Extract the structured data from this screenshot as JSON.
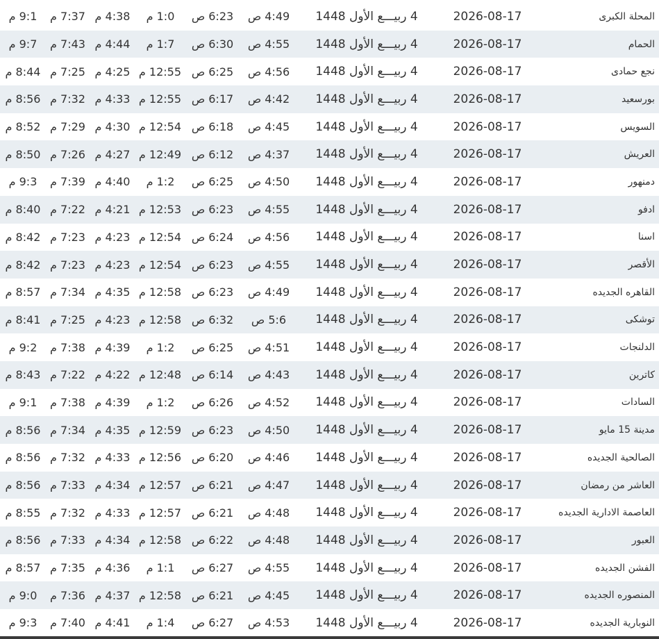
{
  "rows": [
    {
      "city": "المحلة الكبرى",
      "greg": "2026-08-17",
      "hijri": "4 ربيـــع الأول 1448",
      "fajr": "4:49 ص",
      "shuruq": "6:23 ص",
      "dhuhr": "1:0 م",
      "asr": "4:38 م",
      "maghrib": "7:37 م",
      "isha": "9:1 م"
    },
    {
      "city": "الحمام",
      "greg": "2026-08-17",
      "hijri": "4 ربيـــع الأول 1448",
      "fajr": "4:55 ص",
      "shuruq": "6:30 ص",
      "dhuhr": "1:7 م",
      "asr": "4:44 م",
      "maghrib": "7:43 م",
      "isha": "9:7 م"
    },
    {
      "city": "نجع حمادى",
      "greg": "2026-08-17",
      "hijri": "4 ربيـــع الأول 1448",
      "fajr": "4:56 ص",
      "shuruq": "6:25 ص",
      "dhuhr": "12:55 م",
      "asr": "4:25 م",
      "maghrib": "7:25 م",
      "isha": "8:44 م"
    },
    {
      "city": "بورسعيد",
      "greg": "2026-08-17",
      "hijri": "4 ربيـــع الأول 1448",
      "fajr": "4:42 ص",
      "shuruq": "6:17 ص",
      "dhuhr": "12:55 م",
      "asr": "4:33 م",
      "maghrib": "7:32 م",
      "isha": "8:56 م"
    },
    {
      "city": "السويس",
      "greg": "2026-08-17",
      "hijri": "4 ربيـــع الأول 1448",
      "fajr": "4:45 ص",
      "shuruq": "6:18 ص",
      "dhuhr": "12:54 م",
      "asr": "4:30 م",
      "maghrib": "7:29 م",
      "isha": "8:52 م"
    },
    {
      "city": "العريش",
      "greg": "2026-08-17",
      "hijri": "4 ربيـــع الأول 1448",
      "fajr": "4:37 ص",
      "shuruq": "6:12 ص",
      "dhuhr": "12:49 م",
      "asr": "4:27 م",
      "maghrib": "7:26 م",
      "isha": "8:50 م"
    },
    {
      "city": "دمنهور",
      "greg": "2026-08-17",
      "hijri": "4 ربيـــع الأول 1448",
      "fajr": "4:50 ص",
      "shuruq": "6:25 ص",
      "dhuhr": "1:2 م",
      "asr": "4:40 م",
      "maghrib": "7:39 م",
      "isha": "9:3 م"
    },
    {
      "city": "ادفو",
      "greg": "2026-08-17",
      "hijri": "4 ربيـــع الأول 1448",
      "fajr": "4:55 ص",
      "shuruq": "6:23 ص",
      "dhuhr": "12:53 م",
      "asr": "4:21 م",
      "maghrib": "7:22 م",
      "isha": "8:40 م"
    },
    {
      "city": "اسنا",
      "greg": "2026-08-17",
      "hijri": "4 ربيـــع الأول 1448",
      "fajr": "4:56 ص",
      "shuruq": "6:24 ص",
      "dhuhr": "12:54 م",
      "asr": "4:23 م",
      "maghrib": "7:23 م",
      "isha": "8:42 م"
    },
    {
      "city": "الأقصر",
      "greg": "2026-08-17",
      "hijri": "4 ربيـــع الأول 1448",
      "fajr": "4:55 ص",
      "shuruq": "6:23 ص",
      "dhuhr": "12:54 م",
      "asr": "4:23 م",
      "maghrib": "7:23 م",
      "isha": "8:42 م"
    },
    {
      "city": "القاهره الجديده",
      "greg": "2026-08-17",
      "hijri": "4 ربيـــع الأول 1448",
      "fajr": "4:49 ص",
      "shuruq": "6:23 ص",
      "dhuhr": "12:58 م",
      "asr": "4:35 م",
      "maghrib": "7:34 م",
      "isha": "8:57 م"
    },
    {
      "city": "توشكى",
      "greg": "2026-08-17",
      "hijri": "4 ربيـــع الأول 1448",
      "fajr": "5:6 ص",
      "shuruq": "6:32 ص",
      "dhuhr": "12:58 م",
      "asr": "4:23 م",
      "maghrib": "7:25 م",
      "isha": "8:41 م"
    },
    {
      "city": "الدلنجات",
      "greg": "2026-08-17",
      "hijri": "4 ربيـــع الأول 1448",
      "fajr": "4:51 ص",
      "shuruq": "6:25 ص",
      "dhuhr": "1:2 م",
      "asr": "4:39 م",
      "maghrib": "7:38 م",
      "isha": "9:2 م"
    },
    {
      "city": "كاترين",
      "greg": "2026-08-17",
      "hijri": "4 ربيـــع الأول 1448",
      "fajr": "4:43 ص",
      "shuruq": "6:14 ص",
      "dhuhr": "12:48 م",
      "asr": "4:22 م",
      "maghrib": "7:22 م",
      "isha": "8:43 م"
    },
    {
      "city": "السادات",
      "greg": "2026-08-17",
      "hijri": "4 ربيـــع الأول 1448",
      "fajr": "4:52 ص",
      "shuruq": "6:26 ص",
      "dhuhr": "1:2 م",
      "asr": "4:39 م",
      "maghrib": "7:38 م",
      "isha": "9:1 م"
    },
    {
      "city": "مدينة 15 مايو",
      "greg": "2026-08-17",
      "hijri": "4 ربيـــع الأول 1448",
      "fajr": "4:50 ص",
      "shuruq": "6:23 ص",
      "dhuhr": "12:59 م",
      "asr": "4:35 م",
      "maghrib": "7:34 م",
      "isha": "8:56 م"
    },
    {
      "city": "الصالحية الجديده",
      "greg": "2026-08-17",
      "hijri": "4 ربيـــع الأول 1448",
      "fajr": "4:46 ص",
      "shuruq": "6:20 ص",
      "dhuhr": "12:56 م",
      "asr": "4:33 م",
      "maghrib": "7:32 م",
      "isha": "8:56 م"
    },
    {
      "city": "العاشر من رمضان",
      "greg": "2026-08-17",
      "hijri": "4 ربيـــع الأول 1448",
      "fajr": "4:47 ص",
      "shuruq": "6:21 ص",
      "dhuhr": "12:57 م",
      "asr": "4:34 م",
      "maghrib": "7:33 م",
      "isha": "8:56 م"
    },
    {
      "city": "العاصمة الادارية الجديده",
      "greg": "2026-08-17",
      "hijri": "4 ربيـــع الأول 1448",
      "fajr": "4:48 ص",
      "shuruq": "6:21 ص",
      "dhuhr": "12:57 م",
      "asr": "4:33 م",
      "maghrib": "7:32 م",
      "isha": "8:55 م"
    },
    {
      "city": "العبور",
      "greg": "2026-08-17",
      "hijri": "4 ربيـــع الأول 1448",
      "fajr": "4:48 ص",
      "shuruq": "6:22 ص",
      "dhuhr": "12:58 م",
      "asr": "4:34 م",
      "maghrib": "7:33 م",
      "isha": "8:56 م"
    },
    {
      "city": "الفشن الجديده",
      "greg": "2026-08-17",
      "hijri": "4 ربيـــع الأول 1448",
      "fajr": "4:55 ص",
      "shuruq": "6:27 ص",
      "dhuhr": "1:1 م",
      "asr": "4:36 م",
      "maghrib": "7:35 م",
      "isha": "8:57 م"
    },
    {
      "city": "المنصوره الجديده",
      "greg": "2026-08-17",
      "hijri": "4 ربيـــع الأول 1448",
      "fajr": "4:45 ص",
      "shuruq": "6:21 ص",
      "dhuhr": "12:58 م",
      "asr": "4:37 م",
      "maghrib": "7:36 م",
      "isha": "9:0 م"
    },
    {
      "city": "النوبارية الجديده",
      "greg": "2026-08-17",
      "hijri": "4 ربيـــع الأول 1448",
      "fajr": "4:53 ص",
      "shuruq": "6:27 ص",
      "dhuhr": "1:4 م",
      "asr": "4:41 م",
      "maghrib": "7:40 م",
      "isha": "9:3 م"
    }
  ]
}
